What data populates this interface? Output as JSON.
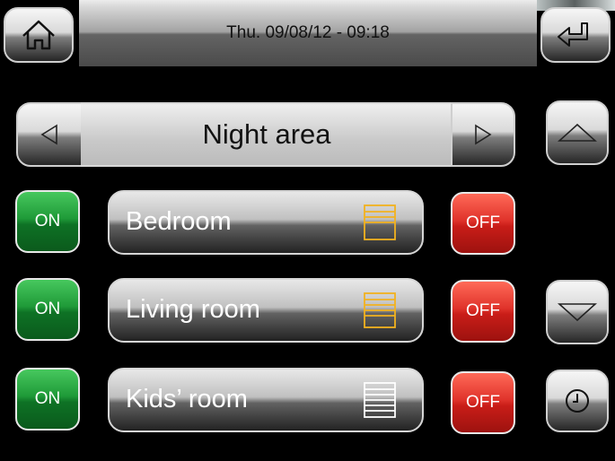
{
  "header": {
    "title": "Thu. 09/08/12 - 09:18",
    "home_icon": "home-icon",
    "back_icon": "return-arrow-icon"
  },
  "area": {
    "name": "Night area",
    "prev_icon": "triangle-left-icon",
    "next_icon": "triangle-right-icon"
  },
  "scroll": {
    "up_icon": "triangle-up-icon",
    "down_icon": "triangle-down-icon",
    "clock_icon": "clock-icon"
  },
  "rooms": [
    {
      "name": "Bedroom",
      "on_label": "ON",
      "off_label": "OFF",
      "icon": "shutter-icon",
      "icon_color": "#f2b21f"
    },
    {
      "name": "Living room",
      "on_label": "ON",
      "off_label": "OFF",
      "icon": "shutter-icon",
      "icon_color": "#f2b21f"
    },
    {
      "name": "Kids’ room",
      "on_label": "ON",
      "off_label": "OFF",
      "icon": "shutter-icon",
      "icon_color": "#ffffff"
    }
  ]
}
